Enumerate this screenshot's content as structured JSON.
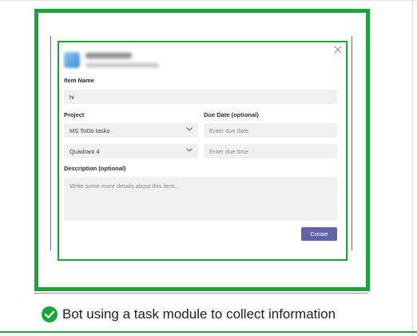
{
  "form": {
    "item_name_label": "Item Name",
    "item_name_value": "hi",
    "project_label": "Project",
    "project_value": "MS ToDo tasks",
    "quadrant_value": "Quadrant 4",
    "due_date_label": "Due Date (optional)",
    "due_date_placeholder": "Enter due date",
    "due_time_placeholder": "Enter due time",
    "description_label": "Description (optional)",
    "description_placeholder": "Write some more details about this item...",
    "create_label": "Create"
  },
  "caption": {
    "text": "Bot using a task module to collect information"
  },
  "colors": {
    "frame_green": "#1aa53a",
    "button_purple": "#6264a7"
  },
  "icons": [
    "close-icon",
    "chevron-down-icon",
    "check-circle-icon",
    "app-icon"
  ]
}
